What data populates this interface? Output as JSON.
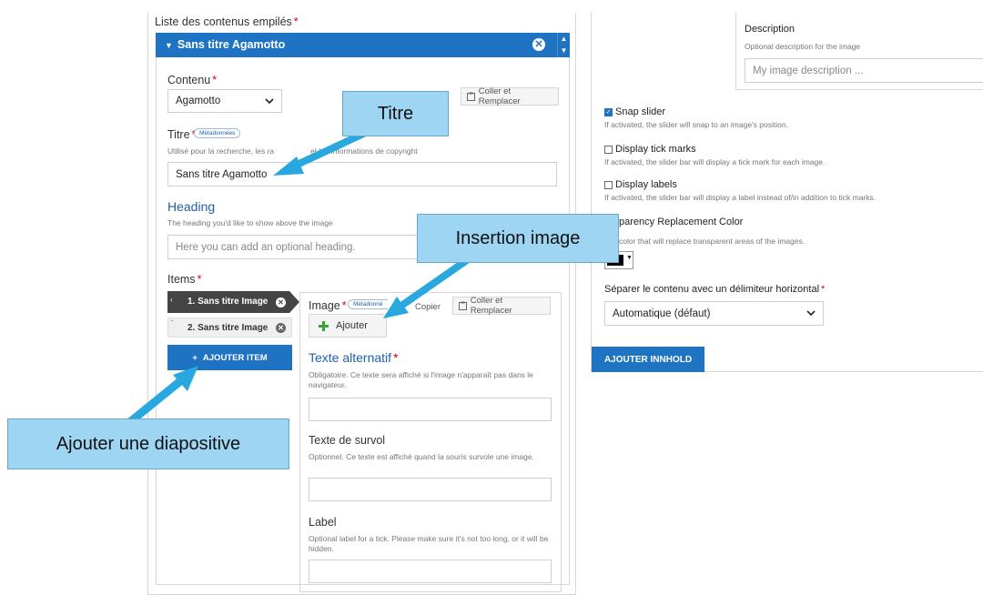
{
  "left": {
    "list_label": "Liste des contenus empilés",
    "req": "*",
    "collapse_title": "Sans titre Agamotto",
    "collapse_toggle": "▼",
    "remove_glyph": "✕",
    "contenu_label": "Contenu",
    "contenu_value": "Agamotto",
    "copy_fragment": "r",
    "coller_remplacer": "Coller et Remplacer",
    "titre_label": "Titre",
    "metadonnees": "Métadonnées",
    "titre_desc": "Utilisé pour la recherche, les ra",
    "titre_desc_tail": "et les informations de copyright",
    "titre_value": "Sans titre Agamotto",
    "heading_label": "Heading",
    "heading_desc": "The heading you'd like to show above the image",
    "heading_placeholder": "Here you can add an optional heading.",
    "items_label": "Items",
    "items": [
      {
        "label": "1. Sans titre Image"
      },
      {
        "label": "2. Sans titre Image"
      }
    ],
    "add_item": "AJOUTER ITEM",
    "add_item_icon": "+",
    "image_label": "Image",
    "image_meta": "Métadonné",
    "copier": "Copier",
    "coller_remplacer_2": "Coller et Remplacer",
    "ajouter": "Ajouter",
    "alt_label": "Texte alternatif",
    "alt_desc": "Obligatoire. Ce texte sera affiché si l'image n'apparaît pas dans le navigateur.",
    "hover_label": "Texte de survol",
    "hover_desc": "Optionnel. Ce texte est affiché quand la souris survole une image.",
    "label_label": "Label",
    "label_desc": "Optional label for a tick. Please make sure it's not too long, or it will be hidden."
  },
  "right": {
    "description_label": "Description",
    "description_desc": "Optional description for the image",
    "description_placeholder": "My image description ...",
    "snap_label": "Snap slider",
    "snap_desc": "If activated, the slider will snap to an image's position.",
    "snap_checked": true,
    "tick_label": "Display tick marks",
    "tick_desc": "If activated, the slider bar will display a tick mark for each image.",
    "labels_label": "Display labels",
    "labels_desc": "If activated, the slider bar will display a label instead of/in addition to tick marks.",
    "transp_label": "parency Replacement Color",
    "transp_desc": "color that will replace transparent areas of the images.",
    "separer_label": "Séparer le contenu avec un délimiteur horizontal",
    "separer_value": "Automatique (défaut)",
    "add_innhold": "AJOUTER INNHOLD"
  },
  "callouts": {
    "titre": "Titre",
    "insertion": "Insertion image",
    "ajouter": "Ajouter une diapositive"
  },
  "colors": {
    "accent": "#1f73c3",
    "callout_fill": "#9dd5f2",
    "arrow": "#29a8e0",
    "required": "#d0021b"
  }
}
